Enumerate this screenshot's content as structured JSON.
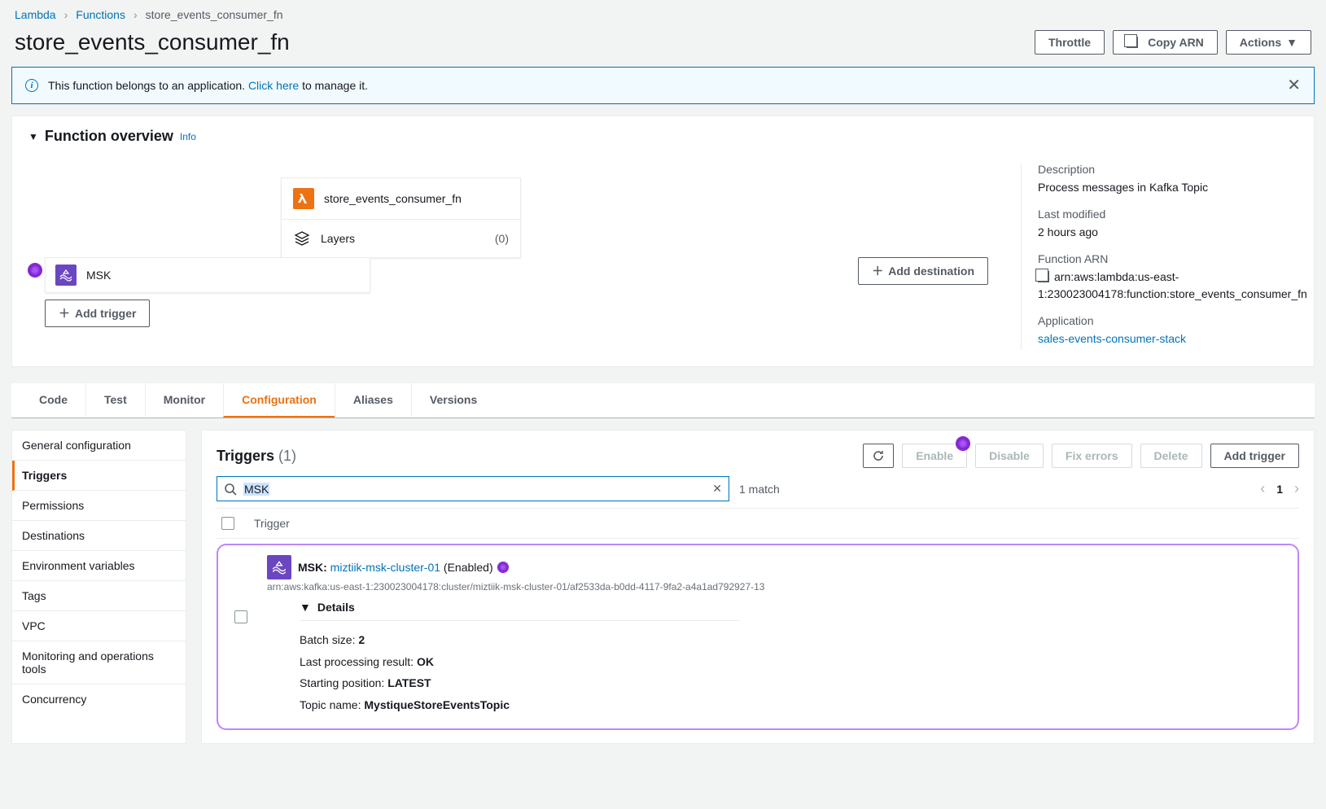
{
  "breadcrumb": {
    "root": "Lambda",
    "functions": "Functions",
    "current": "store_events_consumer_fn"
  },
  "page_title": "store_events_consumer_fn",
  "header_buttons": {
    "throttle": "Throttle",
    "copy_arn": "Copy ARN",
    "actions": "Actions"
  },
  "banner": {
    "text_a": "This function belongs to an application. ",
    "link": "Click here",
    "text_b": " to manage it."
  },
  "overview": {
    "title": "Function overview",
    "info": "Info",
    "fn_name": "store_events_consumer_fn",
    "layers_label": "Layers",
    "layers_count": "(0)",
    "trigger_name": "MSK",
    "add_trigger": "Add trigger",
    "add_destination": "Add destination",
    "desc_label": "Description",
    "desc_value": "Process messages in Kafka Topic",
    "mod_label": "Last modified",
    "mod_value": "2 hours ago",
    "arn_label": "Function ARN",
    "arn_value": "arn:aws:lambda:us-east-1:230023004178:function:store_events_consumer_fn",
    "app_label": "Application",
    "app_value": "sales-events-consumer-stack"
  },
  "tabs": {
    "code": "Code",
    "test": "Test",
    "monitor": "Monitor",
    "configuration": "Configuration",
    "aliases": "Aliases",
    "versions": "Versions"
  },
  "sidebar": {
    "items": [
      "General configuration",
      "Triggers",
      "Permissions",
      "Destinations",
      "Environment variables",
      "Tags",
      "VPC",
      "Monitoring and operations tools",
      "Concurrency"
    ]
  },
  "triggers_panel": {
    "title": "Triggers",
    "count": "(1)",
    "btn_enable": "Enable",
    "btn_disable": "Disable",
    "btn_fix": "Fix errors",
    "btn_delete": "Delete",
    "btn_add": "Add trigger",
    "search_value": "MSK",
    "match_text": "1 match",
    "page_num": "1",
    "col_trigger": "Trigger",
    "row": {
      "service": "MSK:",
      "cluster": "miztiik-msk-cluster-01",
      "status": "(Enabled)",
      "arn": "arn:aws:kafka:us-east-1:230023004178:cluster/miztiik-msk-cluster-01/af2533da-b0dd-4117-9fa2-a4a1ad792927-13",
      "details_label": "Details",
      "batch_label": "Batch size:",
      "batch_value": "2",
      "proc_label": "Last processing result:",
      "proc_value": "OK",
      "start_label": "Starting position:",
      "start_value": "LATEST",
      "topic_label": "Topic name:",
      "topic_value": "MystiqueStoreEventsTopic"
    }
  }
}
